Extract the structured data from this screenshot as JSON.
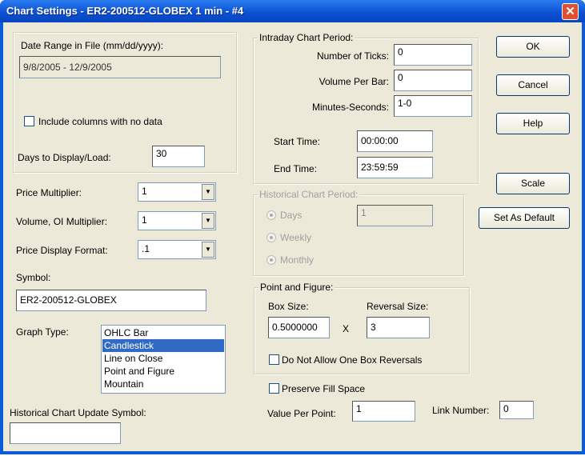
{
  "window": {
    "title": "Chart Settings - ER2-200512-GLOBEX  1 min - #4",
    "close": "✕"
  },
  "date_range": {
    "label": "Date Range in File (mm/dd/yyyy):",
    "value": "9/8/2005 - 12/9/2005",
    "include_no_data": "Include columns with no data",
    "days_label": "Days to Display/Load:",
    "days_value": "30"
  },
  "price_multiplier": {
    "label": "Price Multiplier:",
    "value": "1"
  },
  "volume_multiplier": {
    "label": "Volume, OI Multiplier:",
    "value": "1"
  },
  "price_format": {
    "label": "Price Display Format:",
    "value": ".1"
  },
  "symbol": {
    "label": "Symbol:",
    "value": "ER2-200512-GLOBEX"
  },
  "graph_type": {
    "label": "Graph Type:",
    "options": [
      "OHLC Bar",
      "Candlestick",
      "Line on Close",
      "Point and Figure",
      "Mountain"
    ],
    "selected": "Candlestick"
  },
  "hist_update": {
    "label": "Historical Chart Update Symbol:",
    "value": ""
  },
  "intraday": {
    "title": "Intraday Chart Period:",
    "ticks_label": "Number of Ticks:",
    "ticks": "0",
    "vol_label": "Volume Per Bar:",
    "vol": "0",
    "min_label": "Minutes-Seconds:",
    "min": "1-0",
    "start_label": "Start Time:",
    "start": "00:00:00",
    "end_label": "End Time:",
    "end": "23:59:59"
  },
  "historical": {
    "title": "Historical Chart Period:",
    "days": "Days",
    "days_value": "1",
    "weekly": "Weekly",
    "monthly": "Monthly"
  },
  "pf": {
    "title": "Point and Figure:",
    "box_label": "Box Size:",
    "box": "0.5000000",
    "x": "X",
    "rev_label": "Reversal Size:",
    "rev": "3",
    "no_one_box": "Do Not Allow One Box Reversals"
  },
  "preserve": "Preserve Fill Space",
  "vpp": {
    "label": "Value Per Point:",
    "value": "1"
  },
  "link": {
    "label": "Link Number:",
    "value": "0"
  },
  "buttons": {
    "ok": "OK",
    "cancel": "Cancel",
    "help": "Help",
    "scale": "Scale",
    "default": "Set As Default"
  },
  "arrow": "▼"
}
